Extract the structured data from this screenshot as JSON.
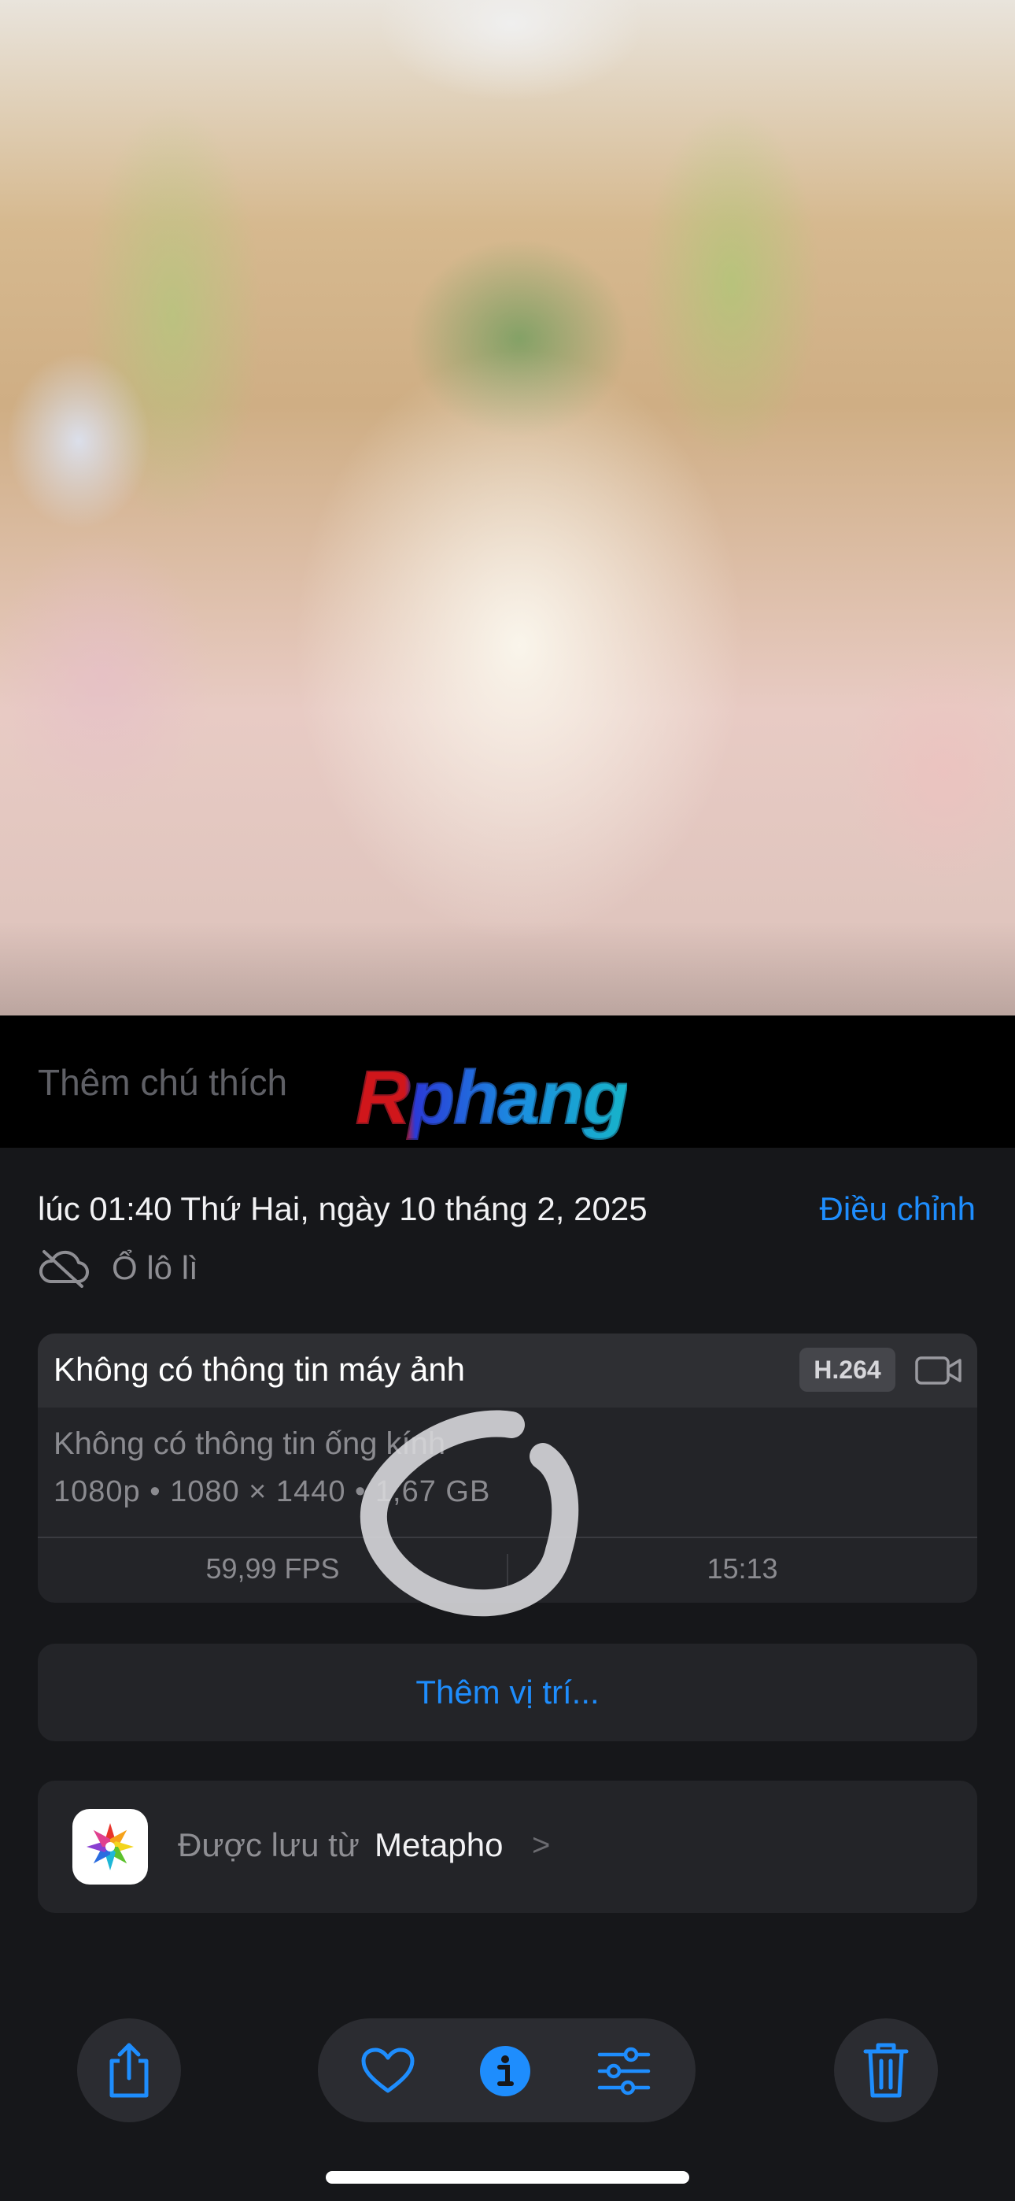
{
  "caption": {
    "placeholder": "Thêm chú thích",
    "watermark": "Rphang"
  },
  "header": {
    "datetime": "lúc 01:40 Thứ Hai, ngày 10 tháng 2, 2025",
    "adjust_label": "Điều chỉnh"
  },
  "cloud_status": {
    "icon": "cloud-off-icon",
    "label": "Ổ lô lì"
  },
  "camera_info": {
    "title": "Không có thông tin máy ảnh",
    "codec": "H.264",
    "lens": "Không có thông tin ống kính",
    "specs": "1080p • 1080 × 1440 • 1,67 GB",
    "fps": "59,99 FPS",
    "duration": "15:13"
  },
  "location": {
    "label": "Thêm vị trí..."
  },
  "source": {
    "prefix": "Được lưu từ",
    "app_name": "Metapho",
    "chevron": ">"
  },
  "toolbar": {
    "icons": [
      "share-icon",
      "heart-icon",
      "info-icon",
      "adjust-icon",
      "trash-icon"
    ]
  },
  "colors": {
    "accent": "#1e8dfd",
    "background": "#16171a",
    "card": "#232428"
  }
}
